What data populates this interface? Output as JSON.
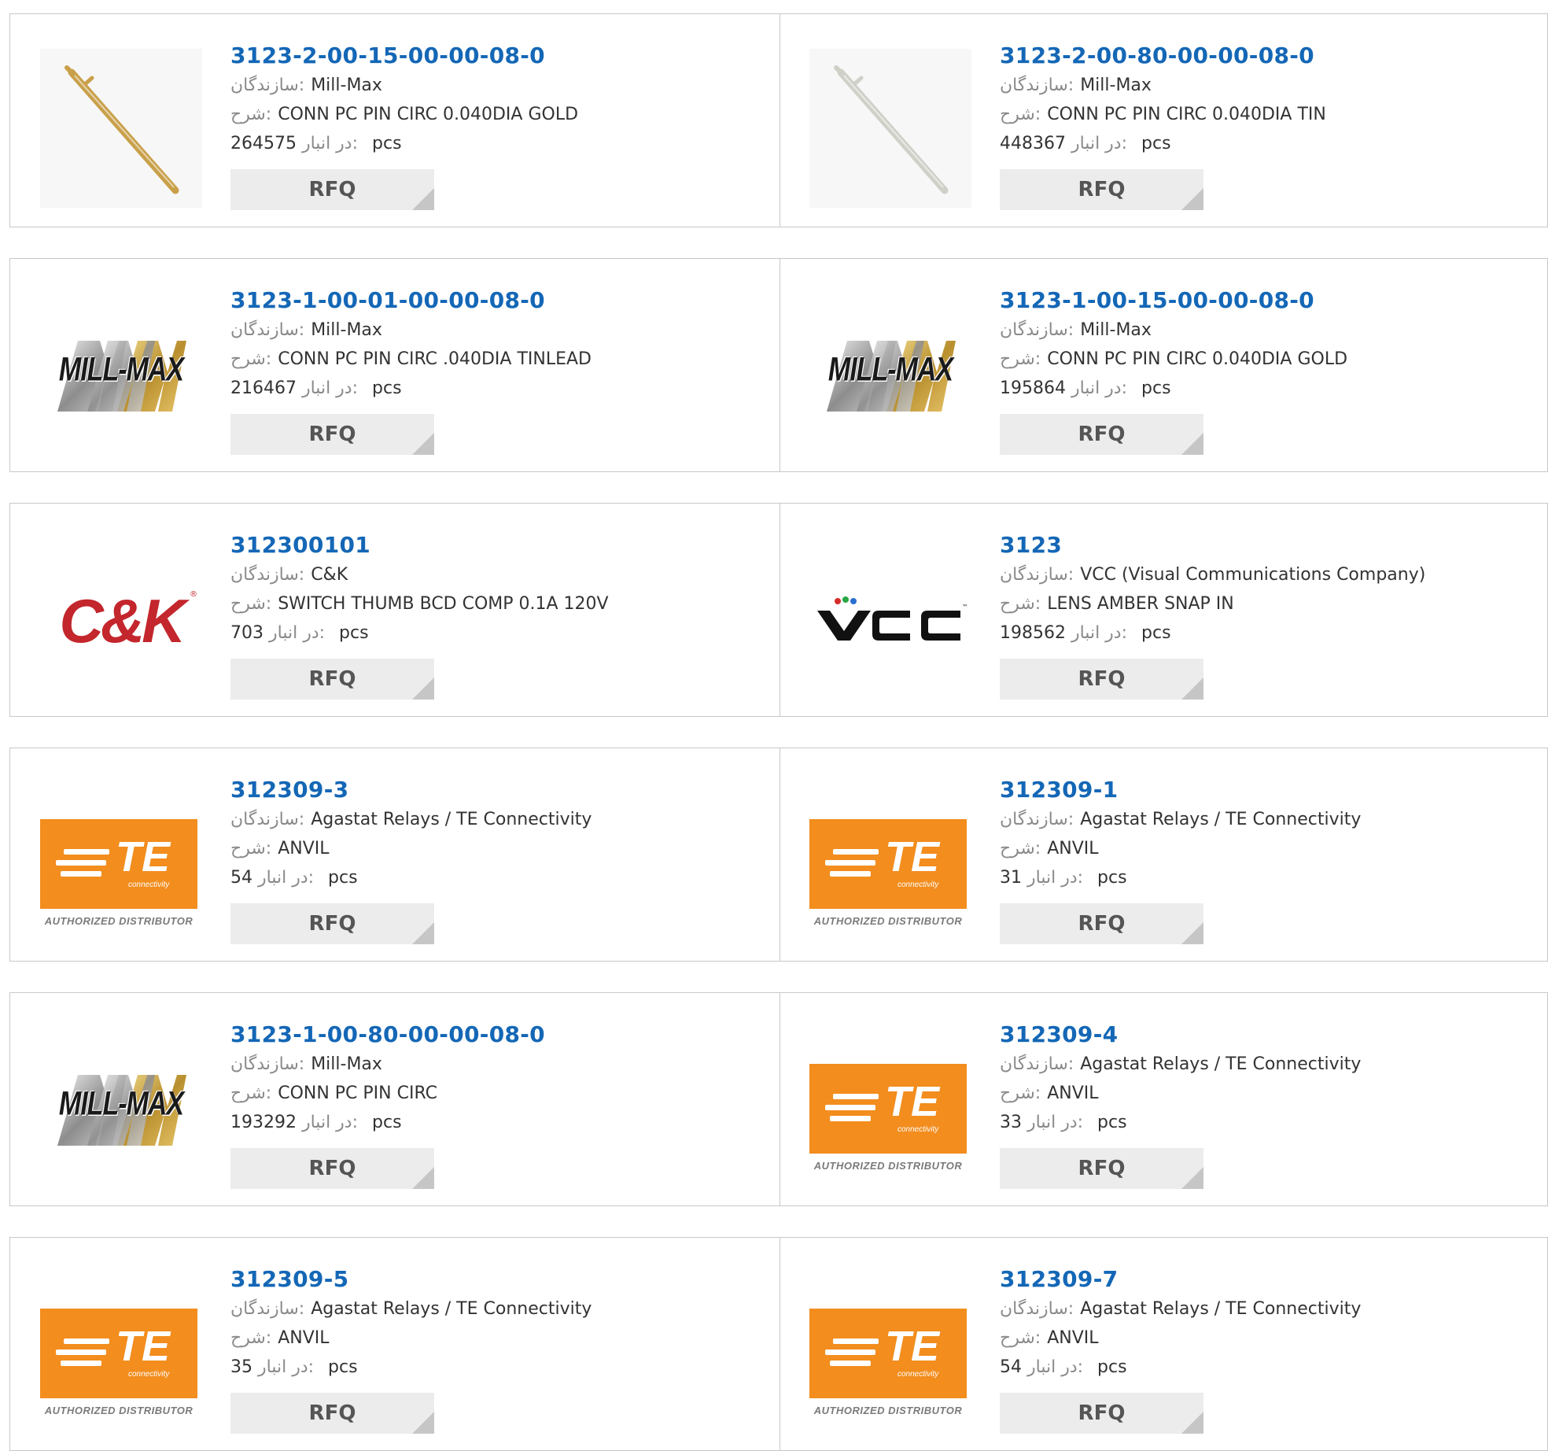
{
  "labels": {
    "manufacturer": "سازندگان:",
    "description": "شرح:",
    "stock": "در انبار:",
    "unit": "pcs",
    "rfq": "RFQ"
  },
  "logos": {
    "ck": "C&K",
    "vcc": "VCC",
    "te": "TE",
    "te_sub": "connectivity",
    "te_authorized": "AUTHORIZED DISTRIBUTOR",
    "millmax": "MILL-MAX"
  },
  "colors": {
    "link": "#1467b6",
    "rfq_bg": "#ececec",
    "te_orange": "#f28d1e",
    "ck_red": "#c3262c"
  },
  "products": [
    {
      "part": "3123-2-00-15-00-00-08-0",
      "manufacturer": "Mill-Max",
      "description": "CONN PC PIN CIRC 0.040DIA GOLD",
      "stock": "264575",
      "image": "gold-pin-image"
    },
    {
      "part": "3123-2-00-80-00-00-08-0",
      "manufacturer": "Mill-Max",
      "description": "CONN PC PIN CIRC 0.040DIA TIN",
      "stock": "448367",
      "image": "silver-pin-image"
    },
    {
      "part": "3123-1-00-01-00-00-08-0",
      "manufacturer": "Mill-Max",
      "description": "CONN PC PIN CIRC .040DIA TINLEAD",
      "stock": "216467",
      "image": "mill-max-logo"
    },
    {
      "part": "3123-1-00-15-00-00-08-0",
      "manufacturer": "Mill-Max",
      "description": "CONN PC PIN CIRC 0.040DIA GOLD",
      "stock": "195864",
      "image": "mill-max-logo"
    },
    {
      "part": "312300101",
      "manufacturer": "C&K",
      "description": "SWITCH THUMB BCD COMP 0.1A 120V",
      "stock": "703",
      "image": "ck-logo"
    },
    {
      "part": "3123",
      "manufacturer": "VCC (Visual Communications Company)",
      "description": "LENS AMBER SNAP IN",
      "stock": "198562",
      "image": "vcc-logo"
    },
    {
      "part": "312309-3",
      "manufacturer": "Agastat Relays / TE Connectivity",
      "description": "ANVIL",
      "stock": "54",
      "image": "te-logo"
    },
    {
      "part": "312309-1",
      "manufacturer": "Agastat Relays / TE Connectivity",
      "description": "ANVIL",
      "stock": "31",
      "image": "te-logo"
    },
    {
      "part": "3123-1-00-80-00-00-08-0",
      "manufacturer": "Mill-Max",
      "description": "CONN PC PIN CIRC",
      "stock": "193292",
      "image": "mill-max-logo"
    },
    {
      "part": "312309-4",
      "manufacturer": "Agastat Relays / TE Connectivity",
      "description": "ANVIL",
      "stock": "33",
      "image": "te-logo"
    },
    {
      "part": "312309-5",
      "manufacturer": "Agastat Relays / TE Connectivity",
      "description": "ANVIL",
      "stock": "35",
      "image": "te-logo"
    },
    {
      "part": "312309-7",
      "manufacturer": "Agastat Relays / TE Connectivity",
      "description": "ANVIL",
      "stock": "54",
      "image": "te-logo"
    }
  ]
}
